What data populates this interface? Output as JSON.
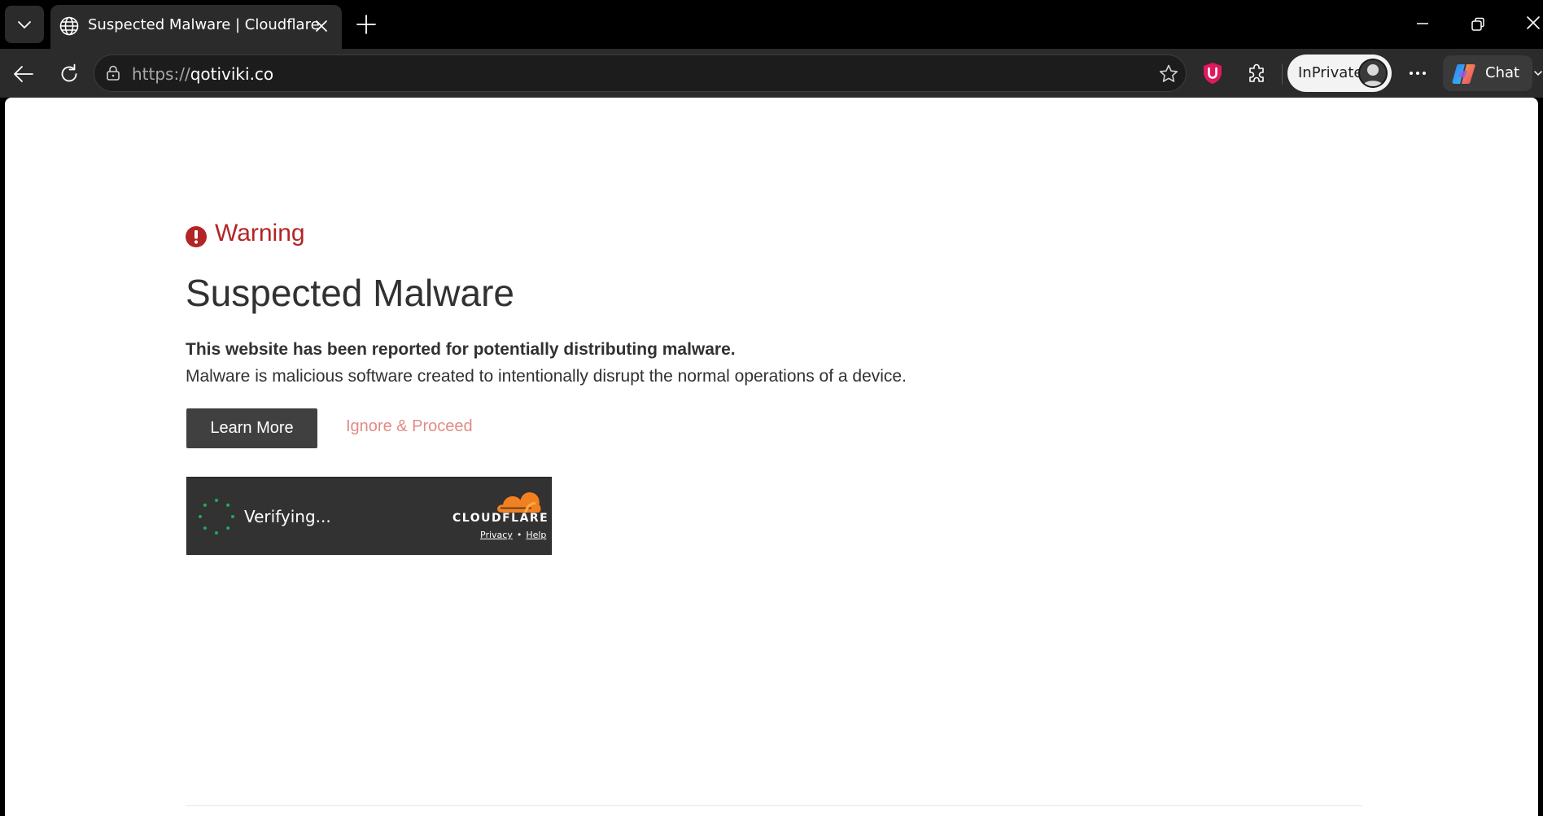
{
  "browser": {
    "tab": {
      "title": "Suspected Malware | Cloudflare"
    },
    "address_bar": {
      "url_scheme": "https://",
      "url_host": "qotiviki.co"
    },
    "profile": {
      "label": "InPrivate"
    },
    "copilot": {
      "label": "Chat"
    },
    "icons": {
      "tab_list": "chevron-down-icon",
      "favicon": "globe-icon",
      "tab_close": "close-icon",
      "new_tab": "plus-icon",
      "back": "arrow-left-icon",
      "reload": "reload-icon",
      "lock": "lock-icon",
      "favorite": "star-icon",
      "ublock": "ublock-shield-icon",
      "extensions": "puzzle-icon",
      "more": "more-dots-icon",
      "copilot": "copilot-icon"
    }
  },
  "page": {
    "warning_label": "Warning",
    "title": "Suspected Malware",
    "description_bold": "This website has been reported for potentially distributing malware.",
    "description": "Malware is malicious software created to intentionally disrupt the normal operations of a device.",
    "learn_more_label": "Learn More",
    "ignore_label": "Ignore & Proceed"
  },
  "turnstile": {
    "status": "Verifying...",
    "brand": "CLOUDFLARE",
    "privacy_label": "Privacy",
    "separator": "•",
    "help_label": "Help"
  },
  "colors": {
    "warning_red": "#b32425",
    "ignore_link": "#e28b86",
    "button_bg": "#404040",
    "cloudflare_orange": "#f38020",
    "spinner_green": "#1fab5a",
    "browser_chrome": "#2b2b2b"
  }
}
